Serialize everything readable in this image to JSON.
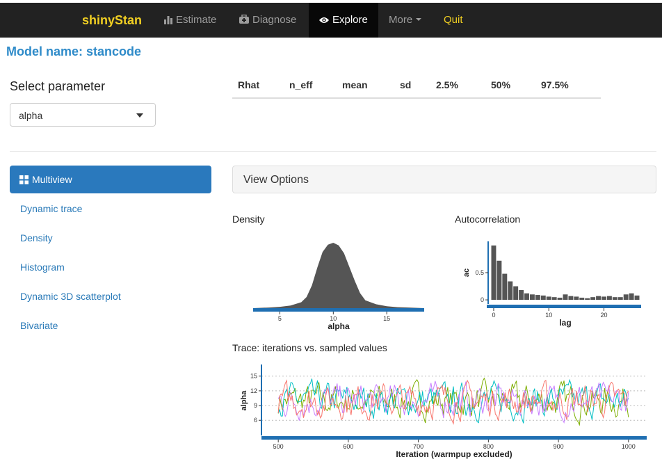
{
  "navbar": {
    "brand": "shinyStan",
    "items": [
      {
        "label": "Estimate",
        "icon": "bar-chart-icon"
      },
      {
        "label": "Diagnose",
        "icon": "medkit-icon"
      },
      {
        "label": "Explore",
        "icon": "eye-icon"
      },
      {
        "label": "More",
        "icon": "chevron-down-icon"
      },
      {
        "label": "Quit",
        "icon": ""
      }
    ]
  },
  "model_name": "Model name: stancode",
  "select": {
    "label": "Select parameter",
    "value": "alpha"
  },
  "stats_columns": [
    "Rhat",
    "n_eff",
    "mean",
    "sd",
    "2.5%",
    "50%",
    "97.5%"
  ],
  "sidebar": {
    "items": [
      {
        "label": "Multiview",
        "icon": "grid-icon"
      },
      {
        "label": "Dynamic trace"
      },
      {
        "label": "Density"
      },
      {
        "label": "Histogram"
      },
      {
        "label": "Dynamic 3D scatterplot"
      },
      {
        "label": "Bivariate"
      }
    ]
  },
  "view_options": "View Options",
  "colors": {
    "navbar_bg": "#222222",
    "brand": "#f2d022",
    "link": "#2a7ab8",
    "active_pill": "#2a79bd",
    "axis_bar": "#1f6fb2",
    "fill_dark": "#555555"
  },
  "chart_data": [
    {
      "type": "area",
      "title": "Density",
      "xlabel": "alpha",
      "ylabel": "",
      "x_ticks": [
        5,
        10,
        15
      ],
      "xlim": [
        2.5,
        18.5
      ],
      "x": [
        2.5,
        4,
        5,
        6,
        7,
        7.5,
        8,
        8.5,
        9,
        9.5,
        10,
        10.5,
        11,
        11.5,
        12,
        12.5,
        13,
        14,
        15,
        16,
        17,
        18.5
      ],
      "y": [
        0,
        0.01,
        0.02,
        0.04,
        0.09,
        0.17,
        0.35,
        0.62,
        0.86,
        0.97,
        1.0,
        0.96,
        0.84,
        0.63,
        0.42,
        0.23,
        0.12,
        0.06,
        0.03,
        0.015,
        0.01,
        0
      ]
    },
    {
      "type": "bar",
      "title": "Autocorrelation",
      "xlabel": "lag",
      "ylabel": "ac",
      "y_ticks": [
        0,
        0.5
      ],
      "x_ticks": [
        0,
        10,
        20
      ],
      "categories": [
        0,
        1,
        2,
        3,
        4,
        5,
        6,
        7,
        8,
        9,
        10,
        11,
        12,
        13,
        14,
        15,
        16,
        17,
        18,
        19,
        20,
        21,
        22,
        23,
        24,
        25,
        26
      ],
      "values": [
        1.0,
        0.72,
        0.48,
        0.34,
        0.25,
        0.18,
        0.12,
        0.1,
        0.09,
        0.08,
        0.06,
        0.05,
        0.04,
        0.1,
        0.07,
        0.06,
        0.04,
        0.03,
        0.05,
        0.07,
        0.06,
        0.07,
        0.05,
        0.05,
        0.1,
        0.12,
        0.08
      ],
      "ylim": [
        -0.05,
        1.05
      ]
    },
    {
      "type": "line",
      "title": "Trace: iterations vs. sampled values",
      "xlabel": "Iteration (warmpup excluded)",
      "ylabel": "alpha",
      "x_ticks": [
        500,
        600,
        700,
        800,
        900,
        1000
      ],
      "y_ticks": [
        6,
        9,
        12,
        15
      ],
      "xlim": [
        476,
        1026
      ],
      "ylim": [
        3.2,
        16.8
      ],
      "series": [
        {
          "color": "#7cae00"
        },
        {
          "color": "#00bfc4"
        },
        {
          "color": "#c77cff"
        },
        {
          "color": "#f8766d"
        }
      ]
    }
  ]
}
